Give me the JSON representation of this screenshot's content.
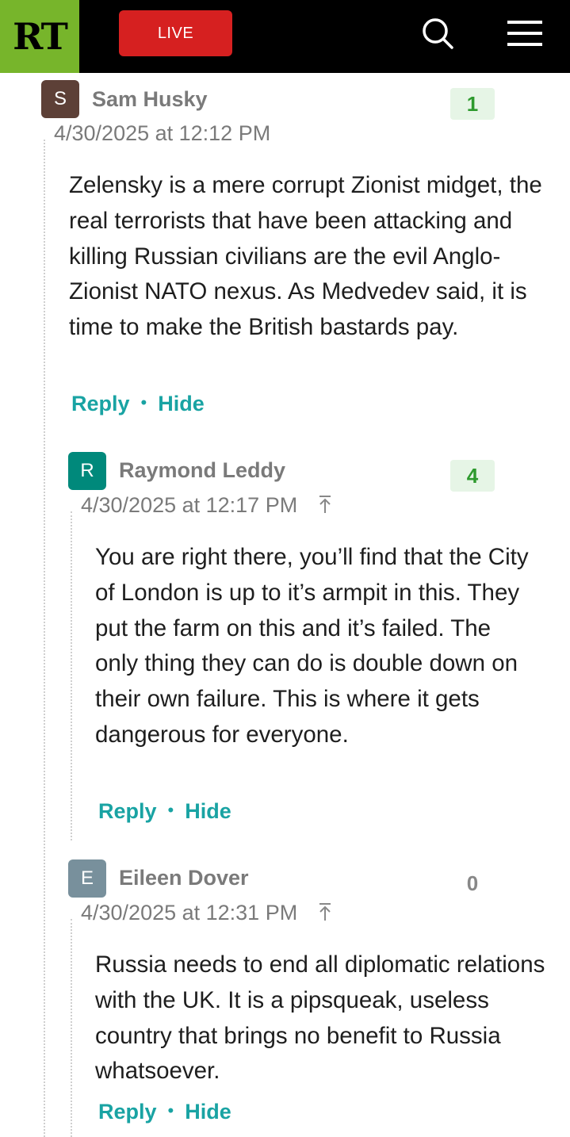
{
  "header": {
    "logo_text": "RT",
    "live_label": "LIVE",
    "search_icon": "search-icon",
    "menu_icon": "hamburger-menu-icon",
    "logo_color": "#77b52b",
    "live_color": "#d62020"
  },
  "comments": [
    {
      "initial": "S",
      "author": "Sam Husky",
      "date": "4/30/2025 at 12:12 PM",
      "score": "1",
      "avatar_color": "#5d4037",
      "body": "Zelensky is a mere corrupt Zionist midget, the real terrorists that have been attacking and killing Russian civilians are the evil Anglo-Zionist NATO nexus. As Medvedev said, it is time to make the British bastards pay.",
      "reply_label": "Reply",
      "separator": "•",
      "hide_label": "Hide"
    },
    {
      "initial": "R",
      "author": "Raymond Leddy",
      "date": "4/30/2025 at 12:17 PM",
      "score": "4",
      "avatar_color": "#00897b",
      "body": "You are right there, you’ll find that the City of London is up to it’s armpit in this. They put the farm on this and it’s failed. The only thing they can do is double down on their own failure. This is where it gets dangerous for everyone.",
      "reply_label": "Reply",
      "separator": "•",
      "hide_label": "Hide"
    },
    {
      "initial": "E",
      "author": "Eileen Dover",
      "date": "4/30/2025 at 12:31 PM",
      "score": "0",
      "avatar_color": "#78909c",
      "body": "Russia needs to end all diplomatic relations with the UK. It is a pipsqueak, useless country that brings no benefit to Russia whatsoever.",
      "reply_label": "Reply",
      "separator": "•",
      "hide_label": "Hide"
    }
  ],
  "colors": {
    "action": "#19a3a3",
    "score_positive": "#2e9a2e",
    "score_positive_bg": "#e6f5e6"
  }
}
